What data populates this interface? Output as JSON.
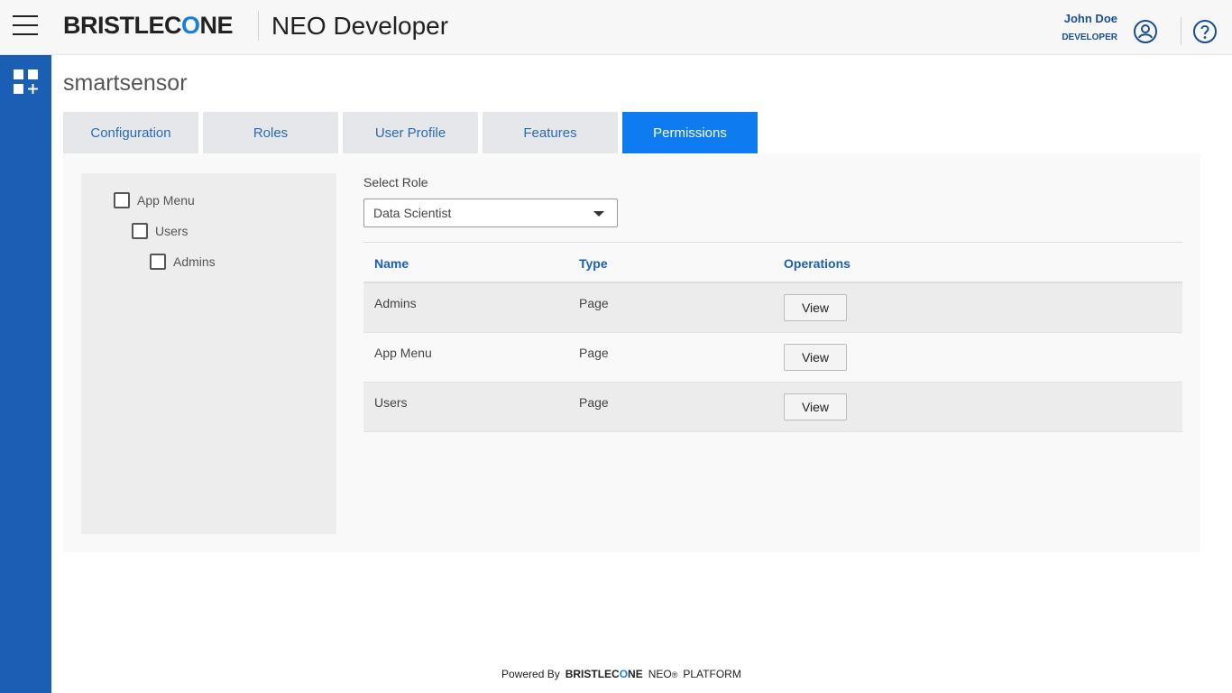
{
  "header": {
    "logo_pre": "BRISTLEC",
    "logo_o": "O",
    "logo_post": "NE",
    "app_title": "NEO Developer",
    "user_name": "John Doe",
    "user_role": "DEVELOPER"
  },
  "page": {
    "title": "smartsensor"
  },
  "tabs": [
    {
      "label": "Configuration"
    },
    {
      "label": "Roles"
    },
    {
      "label": "User Profile"
    },
    {
      "label": "Features"
    },
    {
      "label": "Permissions",
      "active": true
    }
  ],
  "tree": [
    {
      "label": "App Menu",
      "checked": false
    },
    {
      "label": "Users",
      "checked": false
    },
    {
      "label": "Admins",
      "checked": false
    }
  ],
  "role_select": {
    "label": "Select Role",
    "value": "Data Scientist"
  },
  "table": {
    "headers": {
      "name": "Name",
      "type": "Type",
      "operations": "Operations"
    },
    "rows": [
      {
        "name": "Admins",
        "type": "Page",
        "action": "View"
      },
      {
        "name": "App Menu",
        "type": "Page",
        "action": "View"
      },
      {
        "name": "Users",
        "type": "Page",
        "action": "View"
      }
    ]
  },
  "footer": {
    "powered_by": "Powered By",
    "brand_pre": "BRISTLEC",
    "brand_o": "O",
    "brand_post": "NE",
    "neo": "NEO",
    "reg": "®",
    "platform": "PLATFORM"
  },
  "colors": {
    "rail": "#1a5fb4",
    "active_tab": "#0f7bf0",
    "accent_text": "#1a5fb4"
  },
  "icons": [
    "menu-icon",
    "user-avatar-icon",
    "help-icon",
    "apps-add-icon",
    "dropdown-caret-icon"
  ]
}
